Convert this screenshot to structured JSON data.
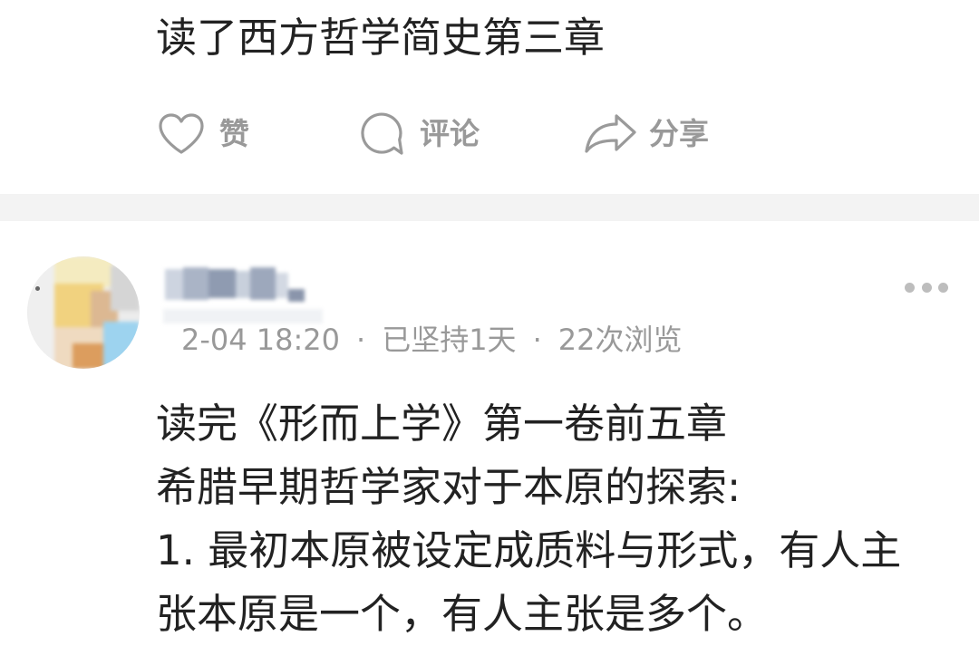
{
  "colors": {
    "text": "#222222",
    "secondary_text": "#999999",
    "icon": "#9a9a9a",
    "divider": "#f3f3f3",
    "more_dots": "#bdbdbd"
  },
  "feed": {
    "post_1": {
      "text": "读了西方哲学简史第三章",
      "actions": {
        "like": {
          "icon": "heart-icon",
          "label": "赞"
        },
        "comment": {
          "icon": "comment-icon",
          "label": "评论"
        },
        "share": {
          "icon": "share-icon",
          "label": "分享"
        }
      }
    },
    "post_2": {
      "meta": {
        "date": "2-04 18:20",
        "separator": "·",
        "streak": "已坚持1天",
        "views": "22次浏览"
      },
      "more_icon": "more-icon",
      "body_lines": [
        "读完《形而上学》第一卷前五章",
        "希腊早期哲学家对于本原的探索:",
        "1. 最初本原被设定成质料与形式，有人主",
        "张本原是一个，有人主张是多个。"
      ]
    }
  }
}
